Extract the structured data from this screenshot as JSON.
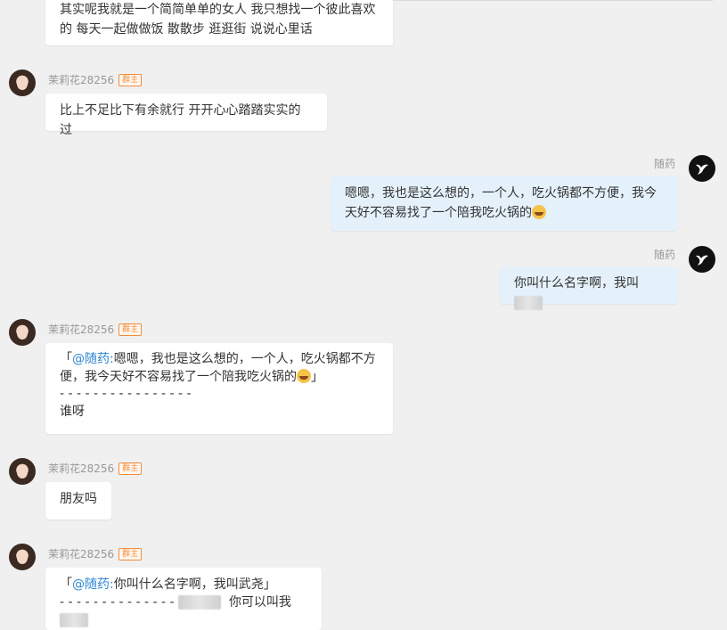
{
  "messages": [
    {
      "id": "m1",
      "side": "left",
      "name": "",
      "badge": "",
      "text_lines": [
        "其实呢我就是一个简简单单的女人 我只想找一个彼此喜欢",
        "的 每天一起做做饭 散散步 逛逛街 说说心里话"
      ]
    },
    {
      "id": "m2",
      "side": "left",
      "name": "茉莉花28256",
      "badge": "群主",
      "text": "比上不足比下有余就行 开开心心踏踏实实的过"
    },
    {
      "id": "m3",
      "side": "right",
      "name": "随药",
      "text_lines": [
        "嗯嗯，我也是这么想的，一个人，吃火锅都不方便，我今",
        "天好不容易找了一个陪我吃火锅的"
      ]
    },
    {
      "id": "m4",
      "side": "right",
      "name": "随药",
      "text": "你叫什么名字啊，我叫"
    },
    {
      "id": "m5",
      "side": "left",
      "name": "茉莉花28256",
      "badge": "群主",
      "quote_open": "「",
      "mention": "@随药:",
      "quote_line1": "嗯嗯，我也是这么想的，一个人，吃火锅都不方",
      "quote_line2": "便，我今天好不容易找了一个陪我吃火锅的",
      "quote_close": "」",
      "dashes": "- - - - - - - - - - - - - - - -",
      "reply": "谁呀"
    },
    {
      "id": "m6",
      "side": "left",
      "name": "茉莉花28256",
      "badge": "群主",
      "text": "朋友吗"
    },
    {
      "id": "m7",
      "side": "left",
      "name": "茉莉花28256",
      "badge": "群主",
      "quote_open": "「",
      "mention": "@随药:",
      "quote_line1": "你叫什么名字啊，我叫武尧",
      "quote_close": "」",
      "dashes": "- - - - - - - - - - - - - -",
      "reply": "你可以叫我"
    }
  ],
  "icons": {
    "left_avatar": "woman-avatar",
    "right_avatar": "bird-logo-icon",
    "emoji": "laughing-emoji-icon"
  },
  "colors": {
    "background": "#f0f0f0",
    "bubble_left": "#ffffff",
    "bubble_right": "#e4f1fb",
    "mention": "#2c85d3",
    "badge": "#f28c3a"
  }
}
